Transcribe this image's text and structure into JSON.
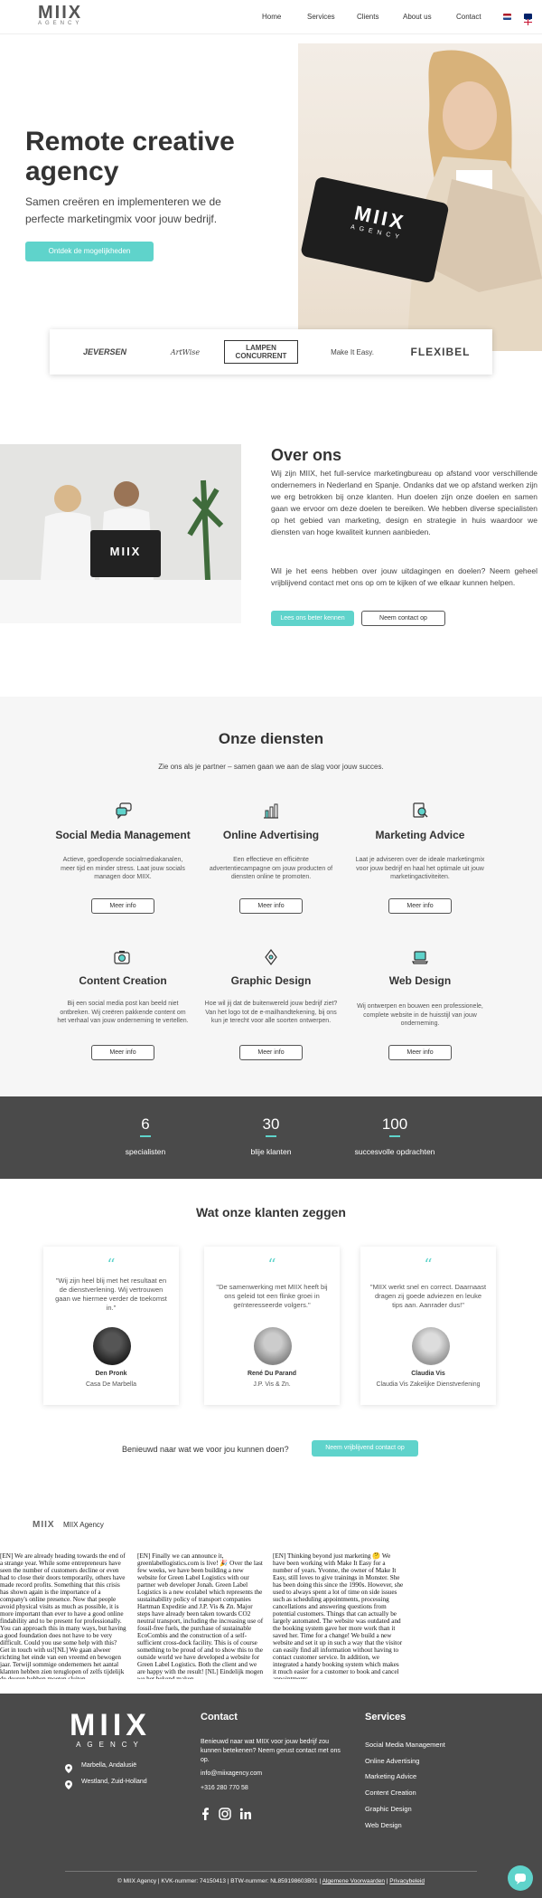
{
  "header": {
    "logo_main": "MIIX",
    "logo_sub": "AGENCY",
    "nav": [
      "Home",
      "Services",
      "Clients",
      "About us",
      "Contact"
    ]
  },
  "hero": {
    "title": "Remote creative agency",
    "subtitle": "Samen creëren en implementeren we de perfecte marketingmix voor jouw bedrijf.",
    "cta": "Ontdek de mogelijkheden",
    "laptop_text_main": "MIIX",
    "laptop_text_sub": "AGENCY"
  },
  "partners": [
    "JEVERSEN",
    "ArtWise",
    "LAMPEN CONCURRENT",
    "Make It Easy.",
    "FLEXIBEL"
  ],
  "about": {
    "title": "Over ons",
    "paragraph1": "Wij zijn MIIX, het full-service marketingbureau op afstand voor verschillende ondernemers in Nederland en Spanje. Ondanks dat we op afstand werken zijn we erg betrokken bij onze klanten. Hun doelen zijn onze doelen en samen gaan we ervoor om deze doelen te bereiken. We hebben diverse specialisten op het gebied van marketing, design en strategie in huis waardoor we diensten van hoge kwaliteit kunnen aanbieden.",
    "paragraph2": "Wil je het eens hebben over jouw uitdagingen en doelen? Neem geheel vrijblijvend contact met ons op om te kijken of we elkaar kunnen helpen.",
    "btn_primary": "Lees ons beter kennen",
    "btn_secondary": "Neem contact op",
    "laptop_text": "MIIX"
  },
  "services": {
    "title": "Onze diensten",
    "subtitle": "Zie ons als je partner – samen gaan we aan de slag voor jouw succes.",
    "more_label": "Meer info",
    "items": [
      {
        "title": "Social Media Management",
        "desc": "Actieve, goedlopende socialmediakanalen, meer tijd en minder stress. Laat jouw socials managen door MIIX.",
        "icon": "chat-bubbles-icon"
      },
      {
        "title": "Online Advertising",
        "desc": "Een effectieve en efficiënte advertentiecampagne om jouw producten of diensten online te promoten.",
        "icon": "bar-chart-icon"
      },
      {
        "title": "Marketing Advice",
        "desc": "Laat je adviseren over de ideale marketingmix voor jouw bedrijf en haal het optimale uit jouw marketingactiviteiten.",
        "icon": "document-search-icon"
      },
      {
        "title": "Content Creation",
        "desc": "Bij een social media post kan beeld niet ontbreken. Wij creëren pakkende content om het verhaal van jouw onderneming te vertellen.",
        "icon": "camera-icon"
      },
      {
        "title": "Graphic Design",
        "desc": "Hoe wil jij dat de buitenwereld jouw bedrijf ziet? Van het logo tot de e-mailhandtekening, bij ons kun je terecht voor alle soorten ontwerpen.",
        "icon": "pen-tool-icon"
      },
      {
        "title": "Web Design",
        "desc": "Wij ontwerpen en bouwen een professionele, complete website in de huisstijl van jouw onderneming.",
        "icon": "laptop-icon"
      }
    ]
  },
  "stats": [
    {
      "num": "6",
      "label": "specialisten"
    },
    {
      "num": "30",
      "label": "blije klanten"
    },
    {
      "num": "100",
      "label": "succesvolle opdrachten"
    }
  ],
  "testimonials": {
    "title": "Wat onze klanten zeggen",
    "quote_mark": "“",
    "items": [
      {
        "quote": "\"Wij zijn heel blij met het resultaat en de dienstverlening. Wij vertrouwen gaan we hiermee verder de toekomst in.\"",
        "name": "Den Pronk",
        "company": "Casa De Marbella"
      },
      {
        "quote": "\"De samenwerking met MIIX heeft bij ons geleid tot een flinke groei in geïnteresseerde volgers.\"",
        "name": "René Du Parand",
        "company": "J.P. Vis & Zn."
      },
      {
        "quote": "\"MIIX werkt snel en correct. Daarnaast dragen zij goede adviezen en leuke tips aan. Aanrader dus!\"",
        "name": "Claudia Vis",
        "company": "Claudia Vis Zakelijke Dienstverlening"
      }
    ],
    "cta_text": "Benieuwd naar wat we voor jou kunnen doen?",
    "cta_btn": "Neem vrijblijvend contact op"
  },
  "feed": {
    "name": "MIIX Agency",
    "posts": [
      "[EN] We are already heading towards the end of a strange year. While some entrepreneurs have seen the number of customers decline or even had to close their doors temporarily, others have made record profits. Something that this crisis has shown again is the importance of a company's online presence. Now that people avoid physical visits as much as possible, it is more important than ever to have a good online findability and to be present for professionally. You can approach this in many ways, but having a good foundation does not have to be very difficult. Could you use some help with this? Get in touch with us![NL] We gaan alweer richting het einde van een vreemd en bewogen jaar. Terwijl sommige ondernemers het aantal klanten hebben zien teruglopen of zelfs tijdelijk de deuren hebben moeten sluiten,",
      "[EN] Finally we can announce it, greenlabellogistics.com is live! 🎉 Over the last few weeks, we have been building a new website for Green Label Logistics with our partner web developer Jonah. Green Label Logistics is a new ecolabel which represents the sustainability policy of transport companies Hartman Expeditie and J.P. Vis & Zn. Major steps have already been taken towards CO2 neutral transport, including the increasing use of fossil-free fuels, the purchase of sustainable EcoCombis and the construction of a self-sufficient cross-dock facility. This is of course something to be proud of and to show this to the outside world we have developed a website for Green Label Logistics. Both the client and we are happy with the result! [NL] Eindelijk mogen we het bekend maken,",
      "[EN] Thinking beyond just marketing 🤔 We have been working with Make It Easy for a number of years. Yvonne, the owner of Make It Easy, still loves to give trainings in Monster. She has been doing this since the 1990s. However, she used to always spent a lot of time on side issues such as scheduling appointments, processing cancellations and answering questions from potential customers. Things that can actually be largely automated. The website was outdated and the booking system gave her more work than it saved her. Time for a change! We build a new website and set it up in such a way that the visitor can easily find all information without having to contact customer service. In addition, we integrated a handy booking system which makes it much easier for a customer to book and cancel appointments."
    ]
  },
  "footer": {
    "logo_main": "MIIX",
    "logo_sub": "AGENCY",
    "loc1": "Marbella, Andalusië",
    "loc2": "Westland, Zuid-Holland",
    "contact_title": "Contact",
    "contact_text": "Benieuwd naar wat MIIX voor jouw bedrijf zou kunnen betekenen? Neem gerust contact met ons op.",
    "email": "info@miixagency.com",
    "phone": "+316 280 770 58",
    "services_title": "Services",
    "services": [
      "Social Media Management",
      "Online Advertising",
      "Marketing Advice",
      "Content Creation",
      "Graphic Design",
      "Web Design"
    ],
    "bottom": {
      "copyright": "© MIIX Agency",
      "kvk": "KVK-nummer: 74150413",
      "btw": "BTW-nummer: NL859198603B01",
      "terms": "Algemene Voorwaarden",
      "privacy": "Privacybeleid"
    }
  },
  "colors": {
    "accent": "#5fd3cb",
    "dark": "#4a4a4a",
    "light": "#f6f6f6"
  }
}
